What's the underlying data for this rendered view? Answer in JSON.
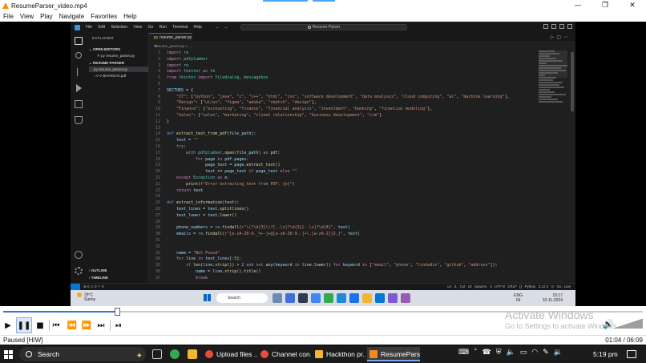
{
  "window": {
    "title": "ResumeParser_video.mp4",
    "minimize": "—",
    "maximize": "❐",
    "close": "✕"
  },
  "player_menu": [
    "File",
    "View",
    "Play",
    "Navigate",
    "Favorites",
    "Help"
  ],
  "vscode": {
    "menu": [
      "File",
      "Edit",
      "Selection",
      "View",
      "Go",
      "Run",
      "Terminal",
      "Help"
    ],
    "search_placeholder": "Resume Parser",
    "explorer": {
      "header": "EXPLORER",
      "open_editors_label": "OPEN EDITORS",
      "open_editor_file": "resume_parser.py",
      "project_label": "RESUME PARSER",
      "files": [
        {
          "name": "resume_parser.py",
          "type": "py"
        },
        {
          "name": "V V BHARGAV.pdf",
          "type": "pdf"
        }
      ],
      "outline_label": "OUTLINE",
      "timeline_label": "TIMELINE"
    },
    "tab": {
      "name": "resume_parser.py"
    },
    "breadcrumb": "resume_parser.py > ...",
    "code_lines": [
      {
        "n": "1",
        "html": "<span class='t-kw'>import</span> <span class='t-mod'>re</span>"
      },
      {
        "n": "2",
        "html": "<span class='t-kw'>import</span> <span class='t-mod'>pdfplumber</span>"
      },
      {
        "n": "3",
        "html": "<span class='t-kw'>import</span> <span class='t-mod'>re</span>"
      },
      {
        "n": "4",
        "html": "<span class='t-kw'>import</span> <span class='t-mod'>tkinter</span> <span class='t-kw'>as</span> <span class='t-mod'>tk</span>"
      },
      {
        "n": "5",
        "html": "<span class='t-kw'>from</span> <span class='t-mod'>tkinter</span> <span class='t-kw'>import</span> <span class='t-mod'>filedialog</span>, <span class='t-mod'>messagebox</span>"
      },
      {
        "n": "6",
        "html": ""
      },
      {
        "n": "7",
        "html": "<span class='t-var'>SECTORS</span> = {"
      },
      {
        "n": "8",
        "html": "    <span class='t-str'>\"IT\"</span>: [<span class='t-str'>\"python\"</span>, <span class='t-str'>\"java\"</span>, <span class='t-str'>\"c\"</span>, <span class='t-str'>\"c++\"</span>, <span class='t-str'>\"html\"</span>, <span class='t-str'>\"css\"</span>, <span class='t-str'>\"software development\"</span>, <span class='t-str'>\"data analysis\"</span>, <span class='t-str'>\"cloud computing\"</span>, <span class='t-str'>\"ai\"</span>, <span class='t-str'>\"machine learning\"</span>],"
      },
      {
        "n": "9",
        "html": "    <span class='t-str'>\"Design\"</span>: [<span class='t-str'>\"ui/ux\"</span>, <span class='t-str'>\"figma\"</span>, <span class='t-str'>\"adobe\"</span>, <span class='t-str'>\"sketch\"</span>, <span class='t-str'>\"design\"</span>],"
      },
      {
        "n": "10",
        "html": "    <span class='t-str'>\"Finance\"</span>: [<span class='t-str'>\"accounting\"</span>, <span class='t-str'>\"finance\"</span>, <span class='t-str'>\"financial analysis\"</span>, <span class='t-str'>\"investment\"</span>, <span class='t-str'>\"banking\"</span>, <span class='t-str'>\"financial modeling\"</span>],"
      },
      {
        "n": "11",
        "html": "    <span class='t-str'>\"Sales\"</span>: [<span class='t-str'>\"sales\"</span>, <span class='t-str'>\"marketing\"</span>, <span class='t-str'>\"client relationship\"</span>, <span class='t-str'>\"business development\"</span>, <span class='t-str'>\"crm\"</span>]"
      },
      {
        "n": "12",
        "html": "}"
      },
      {
        "n": "13",
        "html": ""
      },
      {
        "n": "14",
        "html": "<span class='t-def'>def</span> <span class='t-fn'>extract_text_from_pdf</span>(<span class='t-var'>file_path</span>):"
      },
      {
        "n": "15",
        "html": "    <span class='t-var'>text</span> = <span class='t-str'>\"\"</span>"
      },
      {
        "n": "16",
        "html": "    <span class='t-kw'>try</span>:"
      },
      {
        "n": "17",
        "html": "        <span class='t-kw'>with</span> <span class='t-mod'>pdfplumber</span>.<span class='t-fn'>open</span>(<span class='t-var'>file_path</span>) <span class='t-kw'>as</span> <span class='t-var'>pdf</span>:"
      },
      {
        "n": "18",
        "html": "            <span class='t-kw'>for</span> <span class='t-var'>page</span> <span class='t-kw'>in</span> <span class='t-var'>pdf</span>.<span class='t-var'>pages</span>:"
      },
      {
        "n": "19",
        "html": "                <span class='t-var'>page_text</span> = <span class='t-var'>page</span>.<span class='t-fn'>extract_text</span>()"
      },
      {
        "n": "20",
        "html": "                <span class='t-var'>text</span> += <span class='t-var'>page_text</span> <span class='t-kw'>if</span> <span class='t-var'>page_text</span> <span class='t-kw'>else</span> <span class='t-str'>\"\"</span>"
      },
      {
        "n": "21",
        "html": "    <span class='t-kw'>except</span> <span class='t-mod'>Exception</span> <span class='t-kw'>as</span> <span class='t-var'>e</span>:"
      },
      {
        "n": "22",
        "html": "        <span class='t-fn'>print</span>(<span class='t-str'>f\"Error extracting text from PDF: {e}\"</span>)"
      },
      {
        "n": "23",
        "html": "    <span class='t-kw'>return</span> <span class='t-var'>text</span>"
      },
      {
        "n": "24",
        "html": ""
      },
      {
        "n": "25",
        "html": "<span class='t-def'>def</span> <span class='t-fn'>extract_information</span>(<span class='t-var'>text</span>):"
      },
      {
        "n": "26",
        "html": "    <span class='t-var'>text_lines</span> = <span class='t-var'>text</span>.<span class='t-fn'>splitlines</span>()"
      },
      {
        "n": "27",
        "html": "    <span class='t-var'>text_lower</span> = <span class='t-var'>text</span>.<span class='t-fn'>lower</span>()"
      },
      {
        "n": "28",
        "html": ""
      },
      {
        "n": "29",
        "html": "    <span class='t-var'>phone_numbers</span> = <span class='t-mod'>re</span>.<span class='t-fn'>findall</span>(<span class='t-str'>r\"\\(?\\d{3}\\)?[-.\\s]?\\d{3}[-.\\s]?\\d{4}\"</span>, <span class='t-var'>text</span>)"
      },
      {
        "n": "30",
        "html": "    <span class='t-var'>emails</span> = <span class='t-mod'>re</span>.<span class='t-fn'>findall</span>(<span class='t-str'>r\"[a-zA-Z0-9._%+-]+@[a-zA-Z0-9.-]+\\.[a-zA-Z]{2,}\"</span>, <span class='t-var'>text</span>)"
      },
      {
        "n": "31",
        "html": ""
      },
      {
        "n": "32",
        "html": ""
      },
      {
        "n": "33",
        "html": "    <span class='t-var'>name</span> = <span class='t-str'>\"Not Found\"</span>"
      },
      {
        "n": "34",
        "html": "    <span class='t-kw'>for</span> <span class='t-var'>line</span> <span class='t-kw'>in</span> <span class='t-var'>text_lines</span>[:<span class='t-num'>5</span>]:"
      },
      {
        "n": "35",
        "html": "        <span class='t-kw'>if</span> <span class='t-fn'>len</span>(<span class='t-var'>line</span>.<span class='t-fn'>strip</span>()) &gt; <span class='t-num'>2</span> <span class='t-kw'>and not</span> <span class='t-fn'>any</span>(<span class='t-var'>keyword</span> <span class='t-kw'>in</span> <span class='t-var'>line</span>.<span class='t-fn'>lower</span>() <span class='t-kw'>for</span> <span class='t-var'>keyword</span> <span class='t-kw'>in</span> [<span class='t-str'>\"email\"</span>, <span class='t-str'>\"phone\"</span>, <span class='t-str'>\"linkedin\"</span>, <span class='t-str'>\"github\"</span>, <span class='t-str'>\"address\"</span>]):"
      },
      {
        "n": "36",
        "html": "            <span class='t-var'>name</span> = <span class='t-var'>line</span>.<span class='t-fn'>strip</span>().<span class='t-fn'>title</span>()"
      },
      {
        "n": "37",
        "html": "            <span class='t-kw'>break</span>"
      }
    ],
    "status_left": "⊗ 0 ⚠ 0   ⚐ 0",
    "status_right": "Ln 3, Col 10   Spaces: 4   UTF-8   CRLF   {} Python   3.12.3   ⊙ Go Live"
  },
  "inner_taskbar": {
    "weather_temp": "29°C",
    "weather_desc": "Sunny",
    "search": "Search",
    "lang1": "ENG",
    "lang2": "IN",
    "time": "15:17",
    "date": "10-11-2024"
  },
  "player": {
    "progress": 0.178,
    "status": "Paused [H/W]",
    "time": "01:04 / 06:09",
    "volume": 1.0
  },
  "watermark": {
    "line1": "Activate Windows",
    "line2": "Go to Settings to activate Windows."
  },
  "taskbar": {
    "search": "Search",
    "tasks": [
      {
        "label": "Upload files ...",
        "color": "#e84a3c"
      },
      {
        "label": "Channel con...",
        "color": "#e84a3c"
      },
      {
        "label": "Hackthon pr...",
        "color": "#f2b632"
      },
      {
        "label": "ResumePars...",
        "color": "#f58a1f"
      }
    ],
    "time": "5:19 pm"
  },
  "colors": {
    "accent": "#0078d4",
    "seek_fill": "#2b79d0"
  }
}
